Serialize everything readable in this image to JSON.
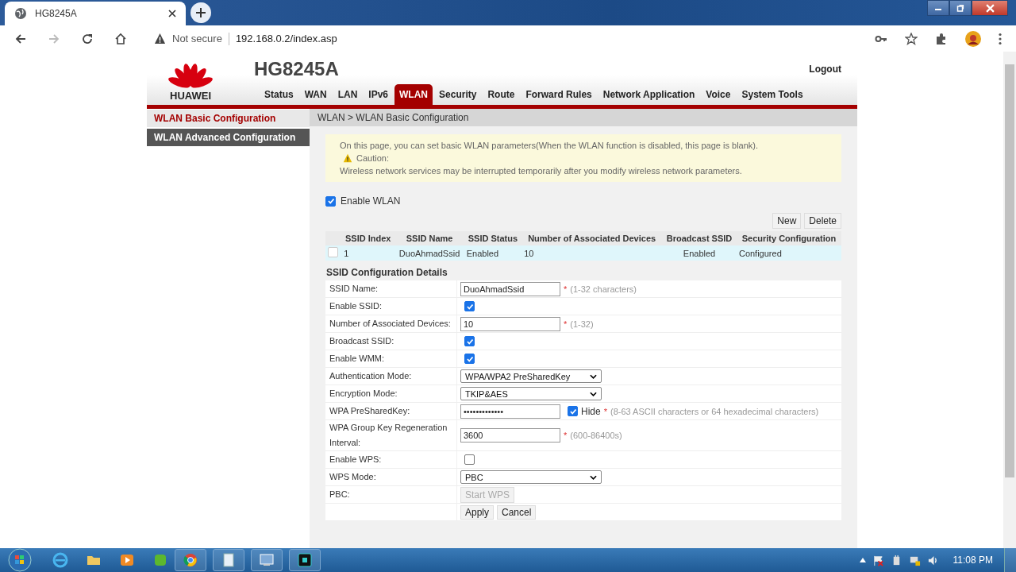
{
  "browser": {
    "tab_title": "HG8245A",
    "security": "Not secure",
    "url": "192.168.0.2/index.asp"
  },
  "router": {
    "model": "HG8245A",
    "brand": "HUAWEI",
    "logout": "Logout",
    "nav": [
      {
        "label": "Status",
        "selected": false
      },
      {
        "label": "WAN",
        "selected": false
      },
      {
        "label": "LAN",
        "selected": false
      },
      {
        "label": "IPv6",
        "selected": false
      },
      {
        "label": "WLAN",
        "selected": true
      },
      {
        "label": "Security",
        "selected": false
      },
      {
        "label": "Route",
        "selected": false
      },
      {
        "label": "Forward Rules",
        "selected": false
      },
      {
        "label": "Network Application",
        "selected": false
      },
      {
        "label": "Voice",
        "selected": false
      },
      {
        "label": "System Tools",
        "selected": false
      }
    ],
    "sidebar": [
      {
        "label": "WLAN Basic Configuration",
        "selected": true
      },
      {
        "label": "WLAN Advanced Configuration",
        "selected": false
      }
    ],
    "breadcrumb": "WLAN > WLAN Basic Configuration",
    "notice": {
      "intro": "On this page, you can set basic WLAN parameters(When the WLAN function is disabled, this page is blank).",
      "caution": "Caution:",
      "detail": "Wireless network services may be interrupted temporarily after you modify wireless network parameters."
    },
    "enable_wlan": {
      "label": "Enable WLAN",
      "checked": true
    },
    "table_buttons": [
      "New",
      "Delete"
    ],
    "table": {
      "columns": [
        "SSID Index",
        "SSID Name",
        "SSID Status",
        "Number of Associated Devices",
        "Broadcast SSID",
        "Security Configuration"
      ],
      "rows": [
        {
          "checked": false,
          "cells": [
            "1",
            "DuoAhmadSsid",
            "Enabled",
            "10",
            "Enabled",
            "Configured"
          ]
        }
      ]
    },
    "section_title": "SSID Configuration Details",
    "fields": [
      {
        "kind": "text",
        "label": "SSID Name:",
        "value": "DuoAhmadSsid",
        "mark": "*",
        "hint": "(1-32 characters)"
      },
      {
        "kind": "checkbox",
        "label": "Enable SSID:",
        "checked": true
      },
      {
        "kind": "text",
        "label": "Number of Associated Devices:",
        "value": "10",
        "mark": "*",
        "hint": "(1-32)"
      },
      {
        "kind": "checkbox",
        "label": "Broadcast SSID:",
        "checked": true
      },
      {
        "kind": "checkbox",
        "label": "Enable WMM:",
        "checked": true
      },
      {
        "kind": "select",
        "label": "Authentication Mode:",
        "value": "WPA/WPA2 PreSharedKey"
      },
      {
        "kind": "select",
        "label": "Encryption Mode:",
        "value": "TKIP&AES"
      },
      {
        "kind": "password",
        "label": "WPA PreSharedKey:",
        "value": "•••••••••••••",
        "checked": true,
        "toggle": "Hide",
        "mark": "*",
        "hint": "(8-63 ASCII characters or 64 hexadecimal characters)"
      },
      {
        "kind": "text",
        "label": "WPA Group Key Regeneration Interval:",
        "value": "3600",
        "mark": "*",
        "hint": "(600-86400s)"
      },
      {
        "kind": "checkbox",
        "label": "Enable WPS:",
        "checked": false
      },
      {
        "kind": "select",
        "label": "WPS Mode:",
        "value": "PBC"
      },
      {
        "kind": "button",
        "label": "PBC:",
        "value": "Start WPS",
        "disabled": true
      }
    ],
    "action_buttons": [
      "Apply",
      "Cancel"
    ]
  },
  "taskbar": {
    "clock": "11:08 PM"
  }
}
